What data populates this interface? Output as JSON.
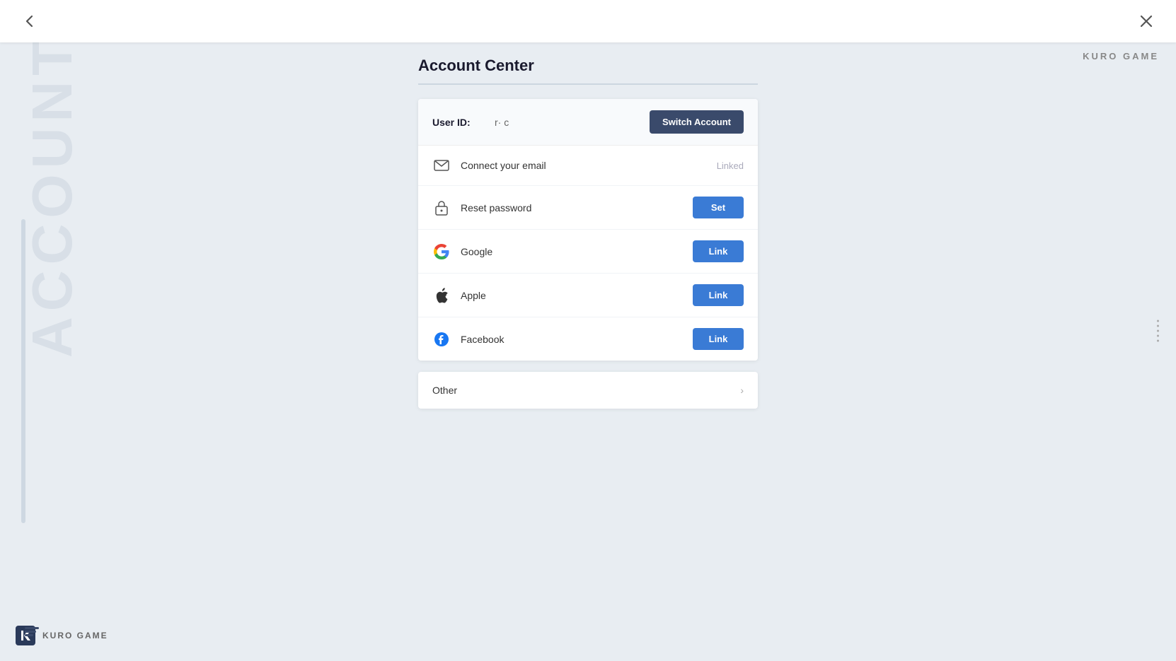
{
  "brand": {
    "name": "KURO GAME",
    "watermark": "ACCOUNT"
  },
  "topbar": {
    "back_label": "‹",
    "close_label": "✕"
  },
  "page": {
    "title": "Account Center",
    "title_underline": true
  },
  "user_id": {
    "label": "User ID:",
    "value": "r· c",
    "switch_button_label": "Switch Account"
  },
  "rows": [
    {
      "id": "connect-email",
      "icon": "email-icon",
      "label": "Connect your email",
      "action_type": "status",
      "action_label": "Linked"
    },
    {
      "id": "reset-password",
      "icon": "lock-icon",
      "label": "Reset password",
      "action_type": "button",
      "action_label": "Set"
    },
    {
      "id": "google",
      "icon": "google-icon",
      "label": "Google",
      "action_type": "button",
      "action_label": "Link"
    },
    {
      "id": "apple",
      "icon": "apple-icon",
      "label": "Apple",
      "action_type": "button",
      "action_label": "Link"
    },
    {
      "id": "facebook",
      "icon": "facebook-icon",
      "label": "Facebook",
      "action_type": "button",
      "action_label": "Link"
    }
  ],
  "other": {
    "label": "Other",
    "chevron": "›"
  },
  "colors": {
    "switch_btn_bg": "#3a4a6b",
    "action_btn_bg": "#3a7bd5",
    "accent": "#3a7bd5"
  }
}
